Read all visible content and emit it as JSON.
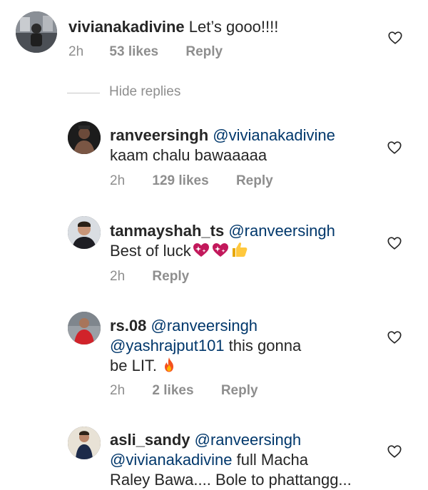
{
  "comments": [
    {
      "username": "vivianakadivine",
      "mention": "",
      "text": "Let’s gooo!!!!",
      "time": "2h",
      "likes": "53 likes",
      "reply": "Reply"
    },
    {
      "username": "ranveersingh",
      "mention": "@vivianakadivine",
      "text": "kaam chalu bawaaaaa",
      "time": "2h",
      "likes": "129 likes",
      "reply": "Reply"
    },
    {
      "username": "tanmayshah_ts",
      "mention": "@ranveersingh",
      "text": "Best of luck",
      "time": "2h",
      "likes": "",
      "reply": "Reply"
    },
    {
      "username": "rs.08",
      "mention": "@ranveersingh",
      "mention2": "@yashrajput101",
      "text_a": "this gonna",
      "text_b": "be LIT.",
      "time": "2h",
      "likes": "2 likes",
      "reply": "Reply"
    },
    {
      "username": "asli_sandy",
      "mention": "@ranveersingh",
      "mention2": "@vivianakadivine",
      "text_a": "full Macha",
      "text_b": "Raley Bawa.... Bole to phattangg..."
    }
  ],
  "hide_replies": "Hide replies",
  "icons": {
    "like": "heart-outline-icon",
    "sparkling_heart": "sparkling-heart-emoji",
    "thumbs_up": "thumbs-up-emoji",
    "fire": "fire-emoji"
  },
  "colors": {
    "text": "#262626",
    "secondary": "#8e8e8e",
    "mention": "#00376b"
  }
}
